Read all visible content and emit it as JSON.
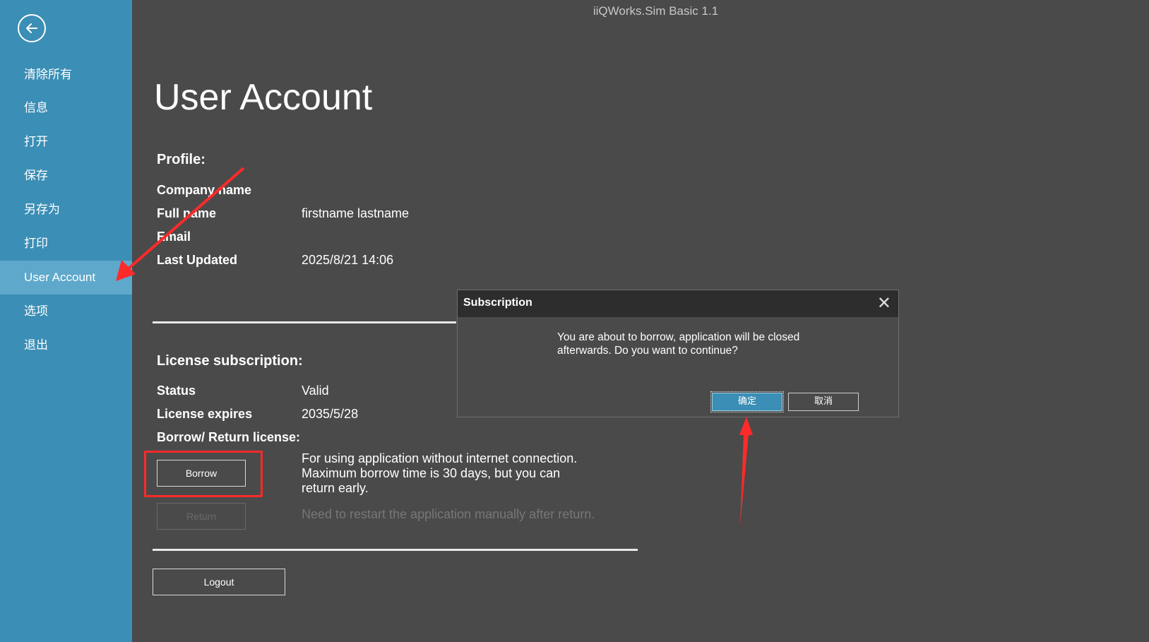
{
  "app_title": "iiQWorks.Sim Basic 1.1",
  "sidebar": {
    "back_icon": "arrow-left-circle-icon",
    "items": [
      {
        "label": "清除所有"
      },
      {
        "label": "信息"
      },
      {
        "label": "打开"
      },
      {
        "label": "保存"
      },
      {
        "label": "另存为"
      },
      {
        "label": "打印"
      },
      {
        "label": "User Account",
        "active": true
      },
      {
        "label": "选项"
      },
      {
        "label": "退出"
      }
    ]
  },
  "page": {
    "title": "User Account",
    "profile": {
      "heading": "Profile:",
      "fields": [
        {
          "label": "Company name",
          "value": ""
        },
        {
          "label": "Full name",
          "value": "firstname lastname"
        },
        {
          "label": "Email",
          "value": ""
        },
        {
          "label": "Last Updated",
          "value": "2025/8/21 14:06"
        }
      ]
    },
    "license": {
      "heading": "License subscription:",
      "status_label": "Status",
      "status_value": "Valid",
      "expires_label": "License expires",
      "expires_value": "2035/5/28",
      "borrow_return_label": "Borrow/ Return license:",
      "borrow_button": "Borrow",
      "borrow_desc": "For using application without internet connection. Maximum borrow time is 30 days, but you can return early.",
      "return_button": "Return",
      "return_desc": "Need to restart the application manually after return."
    },
    "logout_button": "Logout"
  },
  "dialog": {
    "title": "Subscription",
    "close_icon": "close-icon",
    "message": "You are about to borrow, application will be closed afterwards. Do you want to continue?",
    "ok_label": "确定",
    "cancel_label": "取消"
  },
  "colors": {
    "sidebar": "#3b8eb5",
    "sidebar_active": "#5ea8cb",
    "background": "#4a4a4a",
    "annotation": "#ff2a2a"
  }
}
